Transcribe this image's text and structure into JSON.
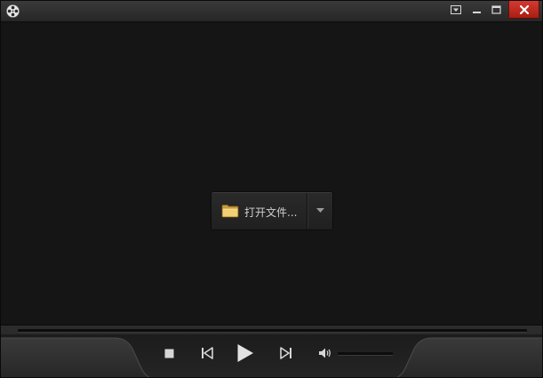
{
  "titlebar": {
    "icons": {
      "app": "film-reel-icon",
      "menu": "dropdown-menu-icon",
      "minimize": "minimize-icon",
      "maximize": "maximize-icon",
      "close": "close-icon"
    },
    "colors": {
      "close_button": "#c9271d"
    }
  },
  "main": {
    "open_button": {
      "label": "打开文件...",
      "icon": "folder-icon",
      "dropdown_icon": "chevron-down-icon"
    }
  },
  "controls": {
    "progress_percent": 0,
    "volume_percent": 0,
    "icons": {
      "stop": "stop-icon",
      "previous": "previous-track-icon",
      "play": "play-icon",
      "next": "next-track-icon",
      "volume": "speaker-icon"
    }
  }
}
